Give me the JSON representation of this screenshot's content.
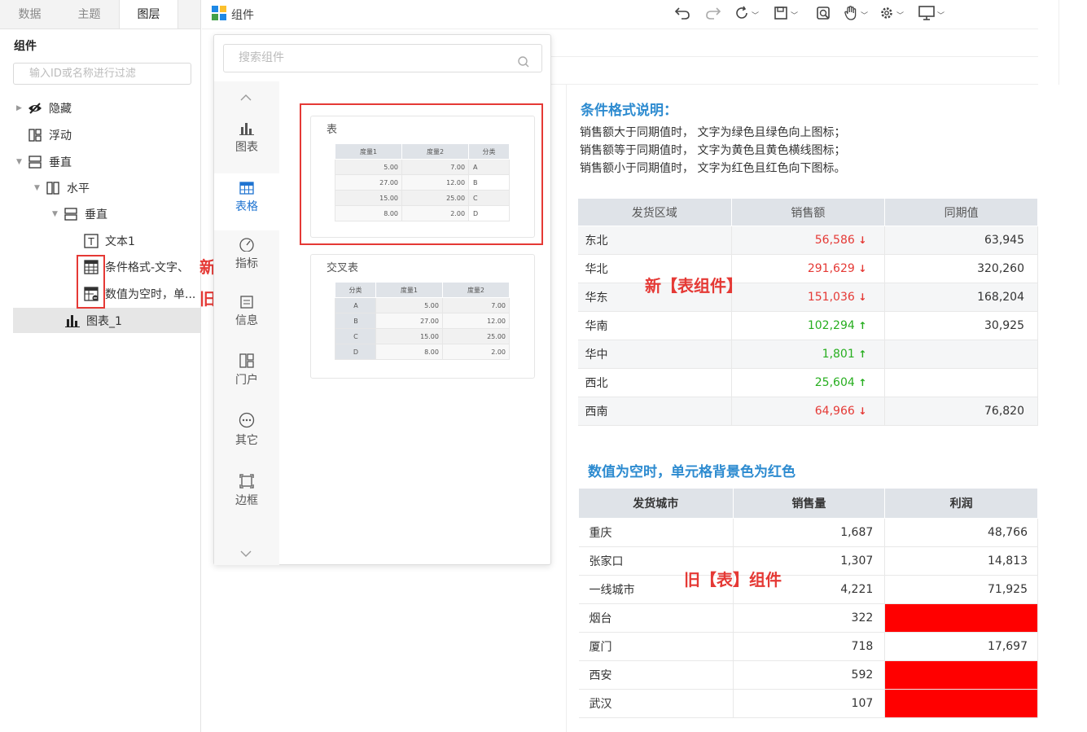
{
  "left_panel": {
    "tabs": [
      "数据",
      "主题",
      "图层"
    ],
    "section_title": "组件",
    "filter_placeholder": "输入ID或名称进行过滤",
    "tree": [
      {
        "label": "隐藏",
        "icon": "eye-icon"
      },
      {
        "label": "浮动",
        "icon": "float-layout-icon"
      },
      {
        "label": "垂直",
        "icon": "vertical-layout-icon"
      },
      {
        "label": "水平",
        "icon": "horizontal-layout-icon"
      },
      {
        "label": "垂直",
        "icon": "vertical-layout-icon"
      },
      {
        "label": "文本1",
        "icon": "text-icon"
      },
      {
        "label": "条件格式-文字、",
        "icon": "table-icon"
      },
      {
        "label": "数值为空时，单...",
        "icon": "old-table-icon"
      },
      {
        "label": "图表_1",
        "icon": "bar-chart-icon"
      }
    ]
  },
  "annotations": {
    "new_table": "新【表组件】",
    "old_table": "旧【表】组件"
  },
  "toolbar": {
    "title": "组件"
  },
  "popup": {
    "search_placeholder": "搜索组件",
    "categories": [
      {
        "label": "图表",
        "icon": "bar-chart-icon"
      },
      {
        "label": "表格",
        "icon": "table-icon"
      },
      {
        "label": "指标",
        "icon": "gauge-icon"
      },
      {
        "label": "信息",
        "icon": "info-icon"
      },
      {
        "label": "门户",
        "icon": "portal-icon"
      },
      {
        "label": "其它",
        "icon": "more-icon"
      },
      {
        "label": "边框",
        "icon": "frame-icon"
      }
    ],
    "cards": [
      {
        "title": "表",
        "headers": [
          "度量1",
          "度量2",
          "分类"
        ],
        "rows": [
          [
            "5.00",
            "7.00",
            "A"
          ],
          [
            "27.00",
            "12.00",
            "B"
          ],
          [
            "15.00",
            "25.00",
            "C"
          ],
          [
            "8.00",
            "2.00",
            "D"
          ]
        ]
      },
      {
        "title": "交叉表",
        "headers": [
          "分类",
          "度量1",
          "度量2"
        ],
        "rows": [
          [
            "A",
            "5.00",
            "7.00"
          ],
          [
            "B",
            "27.00",
            "12.00"
          ],
          [
            "C",
            "15.00",
            "25.00"
          ],
          [
            "D",
            "8.00",
            "2.00"
          ]
        ]
      }
    ]
  },
  "canvas": {
    "cond_title": "条件格式说明：",
    "cond_lines": [
      "销售额大于同期值时， 文字为绿色且绿色向上图标；",
      "销售额等于同期值时， 文字为黄色且黄色横线图标；",
      "销售额小于同期值时， 文字为红色且红色向下图标。"
    ],
    "table1": {
      "headers": [
        "发货区域",
        "销售额",
        "同期值"
      ],
      "rows": [
        {
          "region": "东北",
          "sales": "56,586",
          "trend": "down",
          "prior": "63,945"
        },
        {
          "region": "华北",
          "sales": "291,629",
          "trend": "down",
          "prior": "320,260"
        },
        {
          "region": "华东",
          "sales": "151,036",
          "trend": "down",
          "prior": "168,204"
        },
        {
          "region": "华南",
          "sales": "102,294",
          "trend": "up",
          "prior": "30,925"
        },
        {
          "region": "华中",
          "sales": "1,801",
          "trend": "up",
          "prior": ""
        },
        {
          "region": "西北",
          "sales": "25,604",
          "trend": "up",
          "prior": ""
        },
        {
          "region": "西南",
          "sales": "64,966",
          "trend": "down",
          "prior": "76,820"
        }
      ]
    },
    "null_title": "数值为空时，单元格背景色为红色",
    "table2": {
      "headers": [
        "发货城市",
        "销售量",
        "利润"
      ],
      "rows": [
        {
          "city": "重庆",
          "qty": "1,687",
          "profit": "48,766"
        },
        {
          "city": "张家口",
          "qty": "1,307",
          "profit": "14,813"
        },
        {
          "city": "一线城市",
          "qty": "4,221",
          "profit": "71,925"
        },
        {
          "city": "烟台",
          "qty": "322",
          "profit": ""
        },
        {
          "city": "厦门",
          "qty": "718",
          "profit": "17,697"
        },
        {
          "city": "西安",
          "qty": "592",
          "profit": ""
        },
        {
          "city": "武汉",
          "qty": "107",
          "profit": ""
        }
      ]
    },
    "colors": {
      "red": "#e53935",
      "green": "#27ae1f",
      "null_fill": "#ff0000",
      "title_blue": "#2d8bd0"
    }
  }
}
